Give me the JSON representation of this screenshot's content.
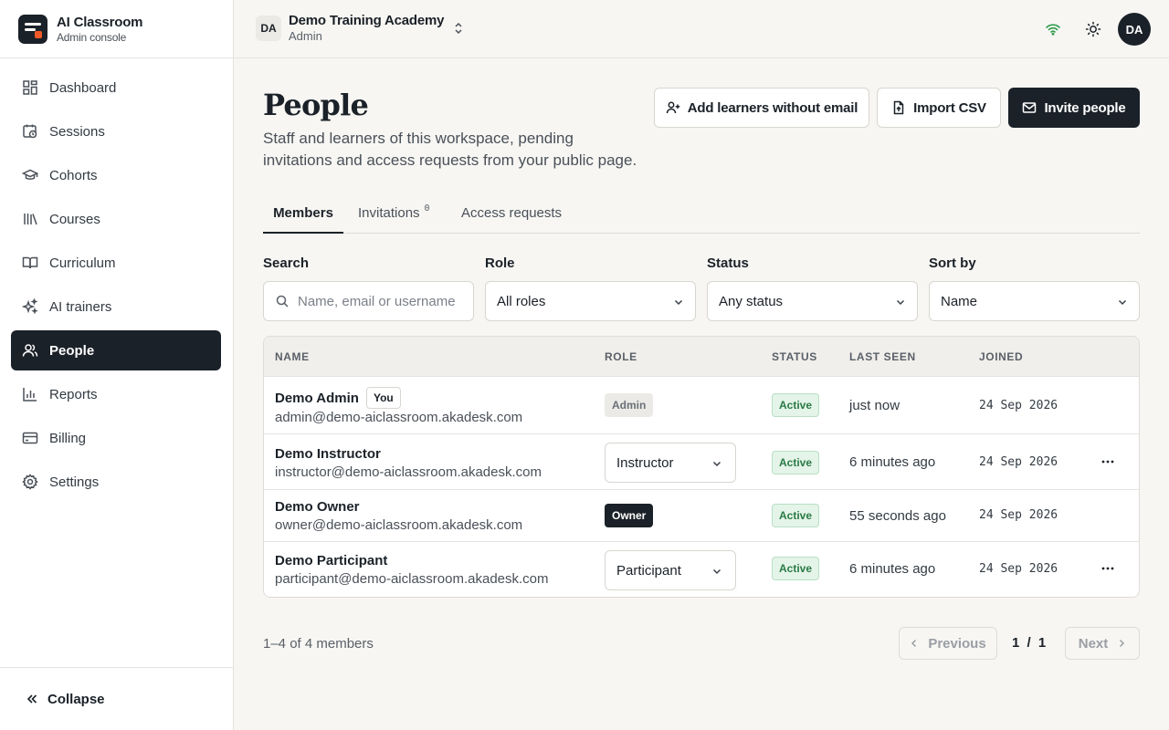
{
  "brand": {
    "title": "AI Classroom",
    "subtitle": "Admin console"
  },
  "sidebar": {
    "items": [
      {
        "label": "Dashboard",
        "icon": "dashboard-icon"
      },
      {
        "label": "Sessions",
        "icon": "sessions-icon"
      },
      {
        "label": "Cohorts",
        "icon": "cohorts-icon"
      },
      {
        "label": "Courses",
        "icon": "courses-icon"
      },
      {
        "label": "Curriculum",
        "icon": "curriculum-icon"
      },
      {
        "label": "AI trainers",
        "icon": "sparkles-icon"
      },
      {
        "label": "People",
        "icon": "people-icon",
        "active": true
      },
      {
        "label": "Reports",
        "icon": "reports-icon"
      },
      {
        "label": "Billing",
        "icon": "billing-icon"
      },
      {
        "label": "Settings",
        "icon": "settings-icon"
      }
    ],
    "collapse_label": "Collapse"
  },
  "topbar": {
    "workspace_initials": "DA",
    "workspace_name": "Demo Training Academy",
    "workspace_role": "Admin",
    "avatar_initials": "DA"
  },
  "page": {
    "title": "People",
    "subtitle": "Staff and learners of this workspace, pending invitations and access requests from your public page."
  },
  "actions": {
    "add_learners": "Add learners without email",
    "import_csv": "Import CSV",
    "invite_people": "Invite people"
  },
  "tabs": [
    {
      "label": "Members",
      "active": true
    },
    {
      "label": "Invitations",
      "count": "0"
    },
    {
      "label": "Access requests"
    }
  ],
  "filters": {
    "search_label": "Search",
    "search_placeholder": "Name, email or username",
    "role_label": "Role",
    "role_value": "All roles",
    "status_label": "Status",
    "status_value": "Any status",
    "sort_label": "Sort by",
    "sort_value": "Name"
  },
  "table": {
    "headers": {
      "name": "NAME",
      "role": "ROLE",
      "status": "STATUS",
      "last_seen": "LAST SEEN",
      "joined": "JOINED"
    },
    "rows": [
      {
        "name": "Demo Admin",
        "you": "You",
        "email": "admin@demo-aiclassroom.akadesk.com",
        "role": "Admin",
        "status": "Active",
        "last_seen": "just now",
        "joined": "24 Sep 2026"
      },
      {
        "name": "Demo Instructor",
        "email": "instructor@demo-aiclassroom.akadesk.com",
        "role": "Instructor",
        "status": "Active",
        "last_seen": "6 minutes ago",
        "joined": "24 Sep 2026"
      },
      {
        "name": "Demo Owner",
        "email": "owner@demo-aiclassroom.akadesk.com",
        "role": "Owner",
        "status": "Active",
        "last_seen": "55 seconds ago",
        "joined": "24 Sep 2026"
      },
      {
        "name": "Demo Participant",
        "email": "participant@demo-aiclassroom.akadesk.com",
        "role": "Participant",
        "status": "Active",
        "last_seen": "6 minutes ago",
        "joined": "24 Sep 2026"
      }
    ]
  },
  "pagination": {
    "summary": "1–4 of 4 members",
    "previous": "Previous",
    "page": "1 / 1",
    "next": "Next"
  },
  "colors": {
    "primary": "#1b2128",
    "accent": "#f05a28",
    "active_green": "#2a7a45",
    "connection": "#2e9b4b"
  }
}
